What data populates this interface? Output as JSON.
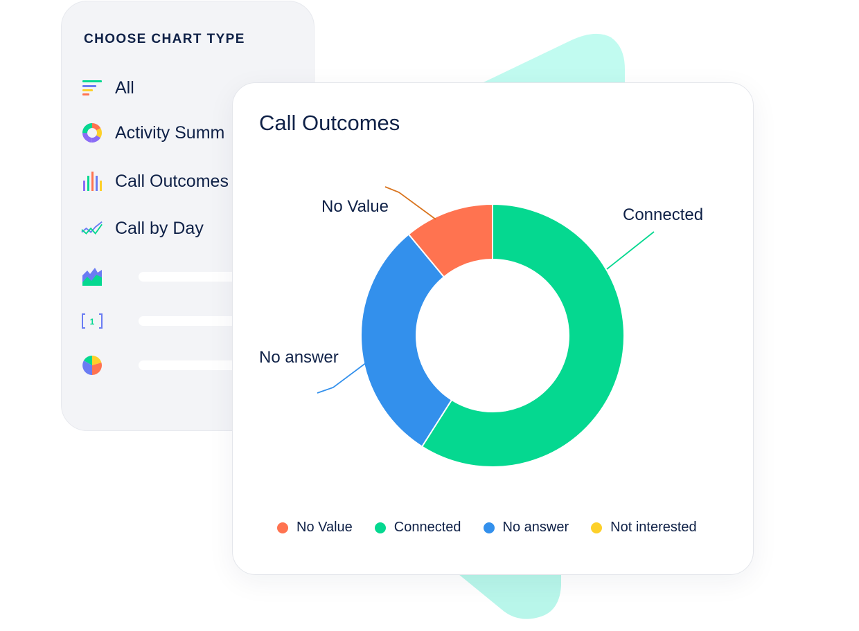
{
  "sidebar": {
    "title": "CHOOSE CHART TYPE",
    "items": [
      {
        "label": "All",
        "icon": "filter-lines-icon"
      },
      {
        "label": "Activity Summ",
        "icon": "donut-chart-icon"
      },
      {
        "label": "Call Outcomes",
        "icon": "bar-chart-icon"
      },
      {
        "label": "Call by Day",
        "icon": "line-chart-icon"
      },
      {
        "label": "",
        "icon": "area-chart-icon"
      },
      {
        "label": "",
        "icon": "number-bracket-icon"
      },
      {
        "label": "",
        "icon": "pie-chart-icon"
      }
    ]
  },
  "card": {
    "title": "Call Outcomes"
  },
  "colors": {
    "no_value": "#ff7350",
    "connected": "#05d890",
    "no_answer": "#3390ec",
    "not_interested": "#fdd02a",
    "text": "#0f2147",
    "teal_shape": "#c1fbf0"
  },
  "chart_data": {
    "type": "pie",
    "subtype": "donut",
    "title": "Call Outcomes",
    "categories": [
      "No Value",
      "Connected",
      "No answer",
      "Not interested"
    ],
    "values": [
      11,
      59,
      30,
      0
    ],
    "unit": "percent (estimated)",
    "callout_labels": [
      "No Value",
      "Connected",
      "No answer"
    ],
    "legend": [
      "No Value",
      "Connected",
      "No answer",
      "Not interested"
    ],
    "legend_placement": "bottom",
    "start_angle_from": "top",
    "direction": "clockwise",
    "slice_order": [
      "Connected",
      "No answer",
      "No Value"
    ]
  }
}
